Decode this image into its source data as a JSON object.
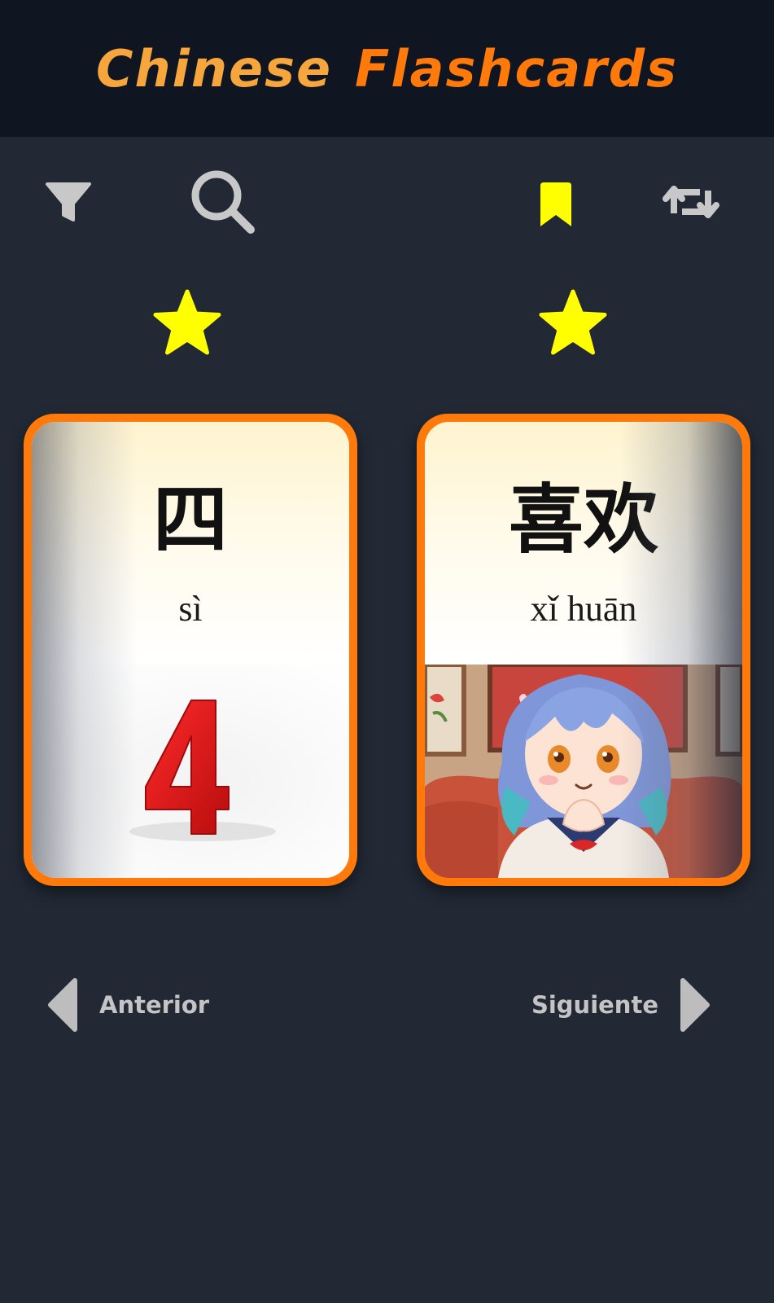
{
  "header": {
    "title_word1": "Chinese",
    "title_word2": "Flashcards"
  },
  "toolbar": {
    "filter_icon": "filter-icon",
    "search_icon": "search-icon",
    "bookmark_icon": "bookmark-icon",
    "swap_icon": "repeat-swap-icon"
  },
  "cards": [
    {
      "hanzi": "四",
      "pinyin": "sì",
      "starred": true,
      "image": "red number 4 on white background"
    },
    {
      "hanzi": "喜欢",
      "pinyin": "xǐ huān",
      "starred": true,
      "image": "anime girl with blue hair, hands clasped, smiling"
    }
  ],
  "navigation": {
    "prev_label": "Anterior",
    "next_label": "Siguiente"
  },
  "colors": {
    "background": "#222935",
    "header_bg": "#0f1622",
    "title_word1": "#f6a63d",
    "title_word2": "#ff7a0a",
    "card_border": "#ff7a0a",
    "star": "#ffff00",
    "bookmark": "#ffff00",
    "icon_gray": "#c8c8c8"
  }
}
